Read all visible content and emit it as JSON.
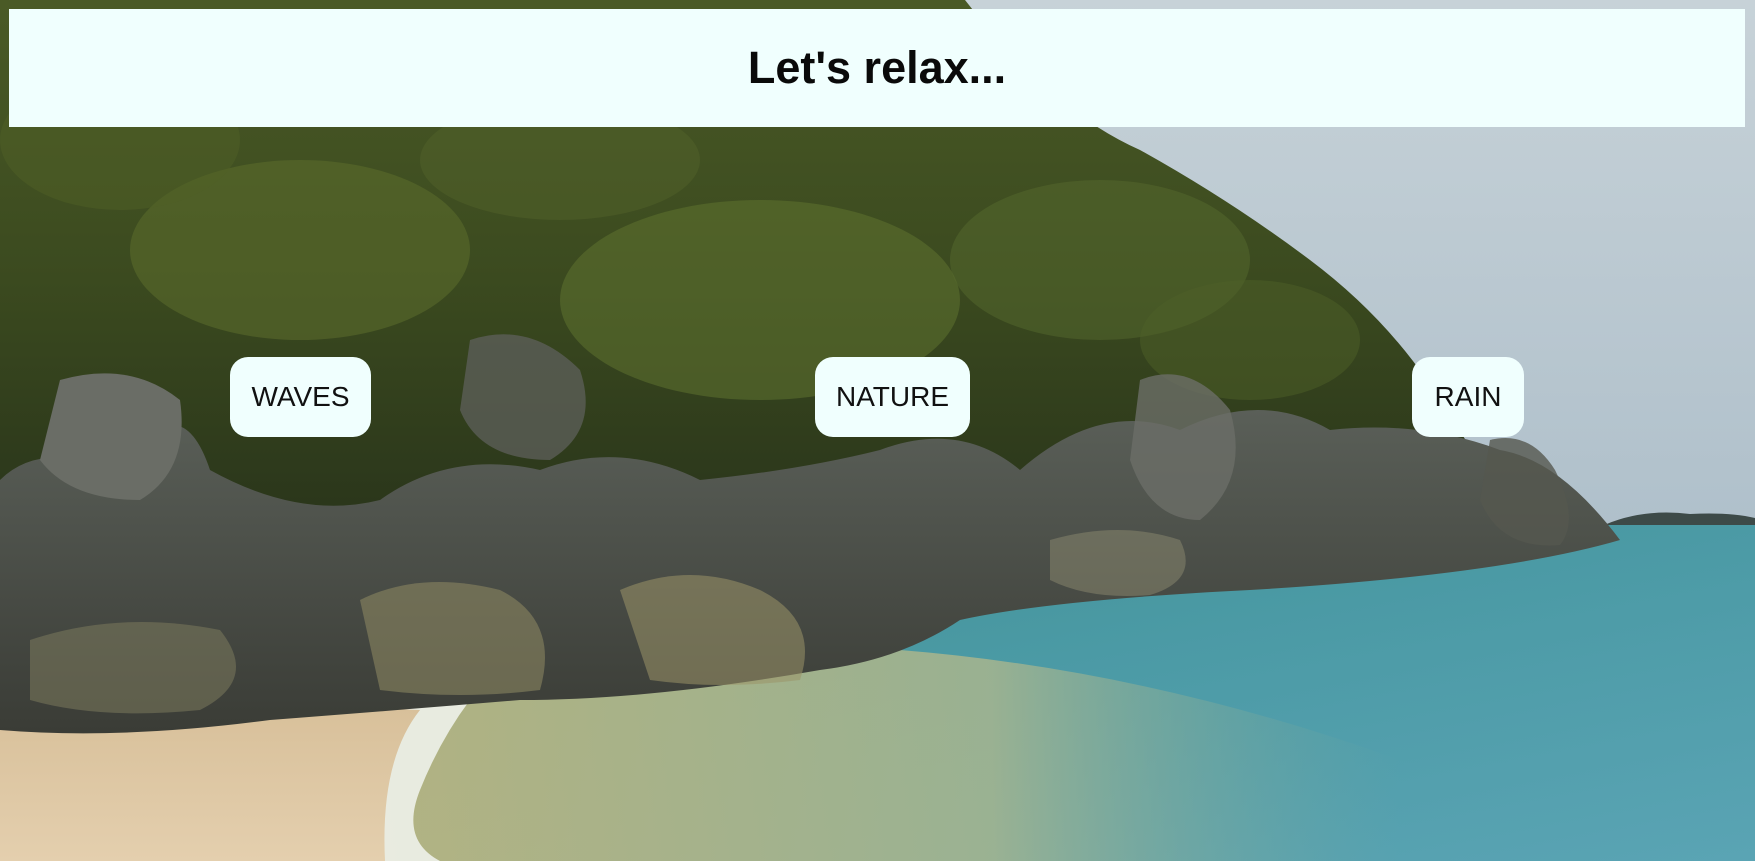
{
  "header": {
    "title": "Let's relax..."
  },
  "buttons": [
    {
      "label": "WAVES"
    },
    {
      "label": "NATURE"
    },
    {
      "label": "RAIN"
    }
  ],
  "colors": {
    "panel_background": "#f0fffe",
    "text": "#0a0a0a"
  }
}
